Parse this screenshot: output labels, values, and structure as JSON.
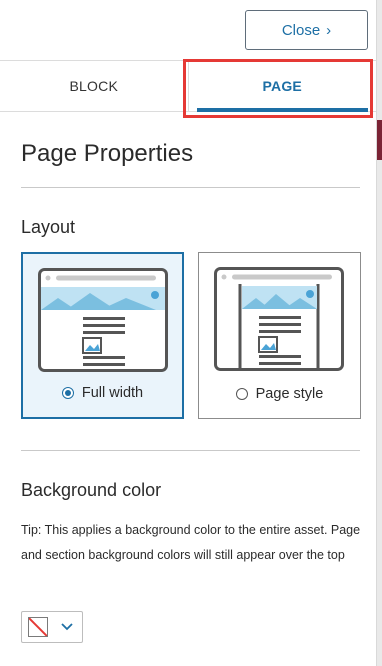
{
  "header": {
    "close_label": "Close"
  },
  "tabs": [
    {
      "label": "BLOCK",
      "active": false
    },
    {
      "label": "PAGE",
      "active": true
    }
  ],
  "page_properties": {
    "title": "Page Properties",
    "layout": {
      "label": "Layout",
      "options": [
        {
          "label": "Full width",
          "selected": true
        },
        {
          "label": "Page style",
          "selected": false
        }
      ]
    },
    "background": {
      "label": "Background color",
      "tip": "Tip: This applies a background color to the entire asset. Page and section background colors will still appear over the top",
      "current": "none"
    }
  },
  "colors": {
    "accent": "#1d6fa5",
    "highlight": "#e53935",
    "selected_bg": "#eaf4fb"
  }
}
